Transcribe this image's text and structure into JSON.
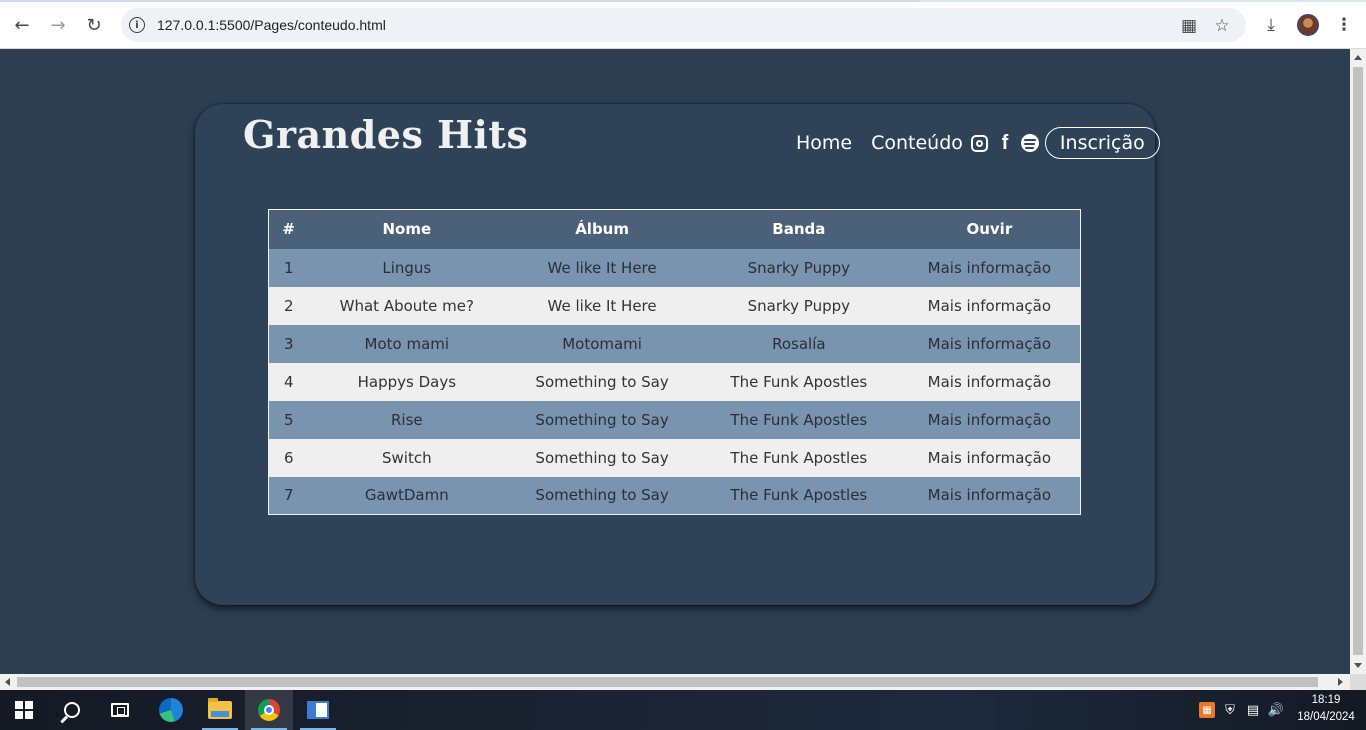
{
  "browser": {
    "url": "127.0.0.1:5500/Pages/conteudo.html",
    "icons": {
      "back": "back-arrow-icon",
      "forward": "forward-arrow-icon",
      "reload": "reload-icon",
      "site_info": "info-icon",
      "translate": "translate-icon",
      "bookmark": "star-icon",
      "download": "download-icon",
      "menu": "kebab-menu-icon"
    }
  },
  "site": {
    "brand": "Grandes Hits",
    "nav": {
      "home": "Home",
      "conteudo": "Conteúdo",
      "subscribe": "Inscrição"
    },
    "social_icons": [
      "instagram-icon",
      "facebook-icon",
      "spotify-icon"
    ]
  },
  "table": {
    "headers": [
      "#",
      "Nome",
      "Álbum",
      "Banda",
      "Ouvir"
    ],
    "rows": [
      {
        "n": "1",
        "nome": "Lingus",
        "album": "We like It Here",
        "banda": "Snarky Puppy",
        "ouvir": "Mais informação"
      },
      {
        "n": "2",
        "nome": "What Aboute me?",
        "album": "We like It Here",
        "banda": "Snarky Puppy",
        "ouvir": "Mais informação"
      },
      {
        "n": "3",
        "nome": "Moto mami",
        "album": "Motomami",
        "banda": "Rosalía",
        "ouvir": "Mais informação"
      },
      {
        "n": "4",
        "nome": "Happys Days",
        "album": "Something to Say",
        "banda": "The Funk Apostles",
        "ouvir": "Mais informação"
      },
      {
        "n": "5",
        "nome": "Rise",
        "album": "Something to Say",
        "banda": "The Funk Apostles",
        "ouvir": "Mais informação"
      },
      {
        "n": "6",
        "nome": "Switch",
        "album": "Something to Say",
        "banda": "The Funk Apostles",
        "ouvir": "Mais informação"
      },
      {
        "n": "7",
        "nome": "GawtDamn",
        "album": "Something to Say",
        "banda": "The Funk Apostles",
        "ouvir": "Mais informação"
      }
    ]
  },
  "colors": {
    "page_bg": "#2d3e51",
    "header_row": "#4b6179",
    "odd_row": "#7894ae",
    "even_row": "#efefef",
    "link": "#2b3ce6"
  },
  "taskbar": {
    "time": "18:19",
    "date": "18/04/2024",
    "apps": [
      "windows-start-icon",
      "search-icon",
      "task-view-icon",
      "edge-icon",
      "file-explorer-icon",
      "chrome-icon",
      "editor-icon"
    ]
  }
}
